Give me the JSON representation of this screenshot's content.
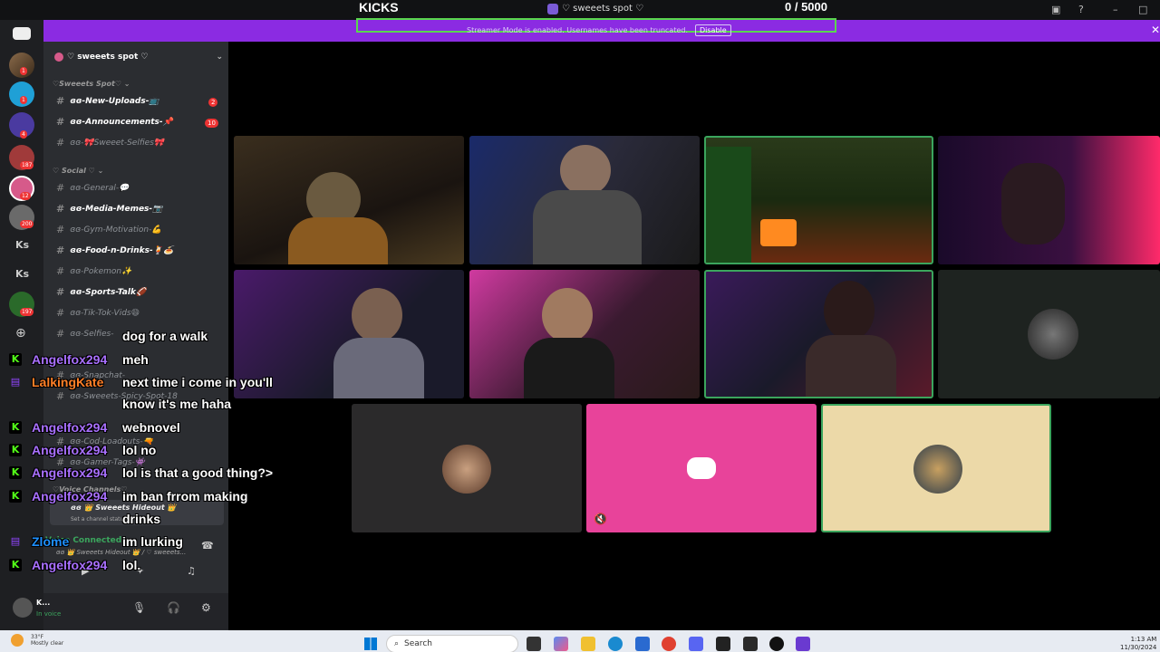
{
  "topbar": {
    "kicks_label": "KICKS",
    "server_name": "♡ sweeets spot ♡",
    "counter": "0  / 5000"
  },
  "banner": {
    "text": "Streamer Mode is enabled. Usernames have been truncated.",
    "button_label": "Disable",
    "accent": "#8b2be2"
  },
  "rail": {
    "items": [
      {
        "badge": "1"
      },
      {
        "badge": "1"
      },
      {
        "badge": "4"
      },
      {
        "badge": "187"
      },
      {
        "badge": "12"
      },
      {
        "badge": "200"
      }
    ],
    "text_items": [
      "Ks",
      "Ks"
    ],
    "badge_197": "197"
  },
  "sidebar": {
    "server_name": "♡ sweeets spot ♡",
    "categories": [
      "♡Sweeets Spot♡ ⌄",
      "♡ Social ♡ ⌄"
    ],
    "channels": [
      {
        "name": "ɞɞ-New-Uploads-📺",
        "badge": "2"
      },
      {
        "name": "ɞɞ-Announcements-📌",
        "badge": "10"
      },
      {
        "name": "ɞɞ-🎀Sweeet-Selfies🎀",
        "badge": ""
      },
      {
        "name": "ɞɞ-General-💬",
        "badge": ""
      },
      {
        "name": "ɞɞ-Media-Memes-📷",
        "badge": ""
      },
      {
        "name": "ɞɞ-Gym-Motivation-💪",
        "badge": ""
      },
      {
        "name": "ɞɞ-Food-n-Drinks-🍹🍝",
        "badge": ""
      },
      {
        "name": "ɞɞ-Pokemon✨",
        "badge": ""
      },
      {
        "name": "ɞɞ-Sports-Talk🏈",
        "badge": ""
      },
      {
        "name": "ɞɞ-Tik-Tok-Vids😄",
        "badge": ""
      },
      {
        "name": "ɞɞ-Selfies-",
        "badge": ""
      },
      {
        "name": "ɞɞ-Snapchat-",
        "badge": ""
      },
      {
        "name": "ɞɞ-Sweeets-Spicy-Spot-18",
        "badge": ""
      },
      {
        "name": "ɞɞ-Cod-Loadouts-🔫",
        "badge": ""
      },
      {
        "name": "ɞɞ-Gamer-Tags-👾",
        "badge": ""
      }
    ],
    "voice_category": "♡Voice Channels♡",
    "voice_channel": "ɞɞ 👑 Sweeets Hideout 👑",
    "voice_sub": "Set a channel status",
    "vc_status": "Voice Connected",
    "vc_sub": "ɞɞ 👑 Sweeets Hideout 👑 / ♡ sweeets...",
    "user_name": "K...",
    "user_status": "In voice"
  },
  "chat": [
    {
      "platform": "",
      "user": "",
      "msg": "dog for a walk",
      "color": "#ffffff"
    },
    {
      "platform": "kick",
      "user": "Angelfox294",
      "msg": "meh",
      "color": "#a970ff"
    },
    {
      "platform": "twitch",
      "user": "LalkingKate",
      "msg": "next time i come in you'll",
      "color": "#ff7f27"
    },
    {
      "platform": "",
      "user": "",
      "msg": "know it's me haha",
      "color": "#ffffff"
    },
    {
      "platform": "kick",
      "user": "Angelfox294",
      "msg": "webnovel",
      "color": "#a970ff"
    },
    {
      "platform": "kick",
      "user": "Angelfox294",
      "msg": "lol no",
      "color": "#a970ff"
    },
    {
      "platform": "kick",
      "user": "Angelfox294",
      "msg": "lol is that a good thing?>",
      "color": "#a970ff"
    },
    {
      "platform": "kick",
      "user": "Angelfox294",
      "msg": "im ban frrom making",
      "color": "#a970ff"
    },
    {
      "platform": "",
      "user": "",
      "msg": "drinks",
      "color": "#ffffff"
    },
    {
      "platform": "twitch",
      "user": "Zlome",
      "msg": "im lurking",
      "color": "#1e90ff"
    },
    {
      "platform": "kick",
      "user": "Angelfox294",
      "msg": "lol.",
      "color": "#a970ff"
    }
  ],
  "taskbar": {
    "temp": "33°F",
    "weather": "Mostly clear",
    "search_placeholder": "Search",
    "time": "1:13 AM",
    "date": "11/30/2024"
  }
}
